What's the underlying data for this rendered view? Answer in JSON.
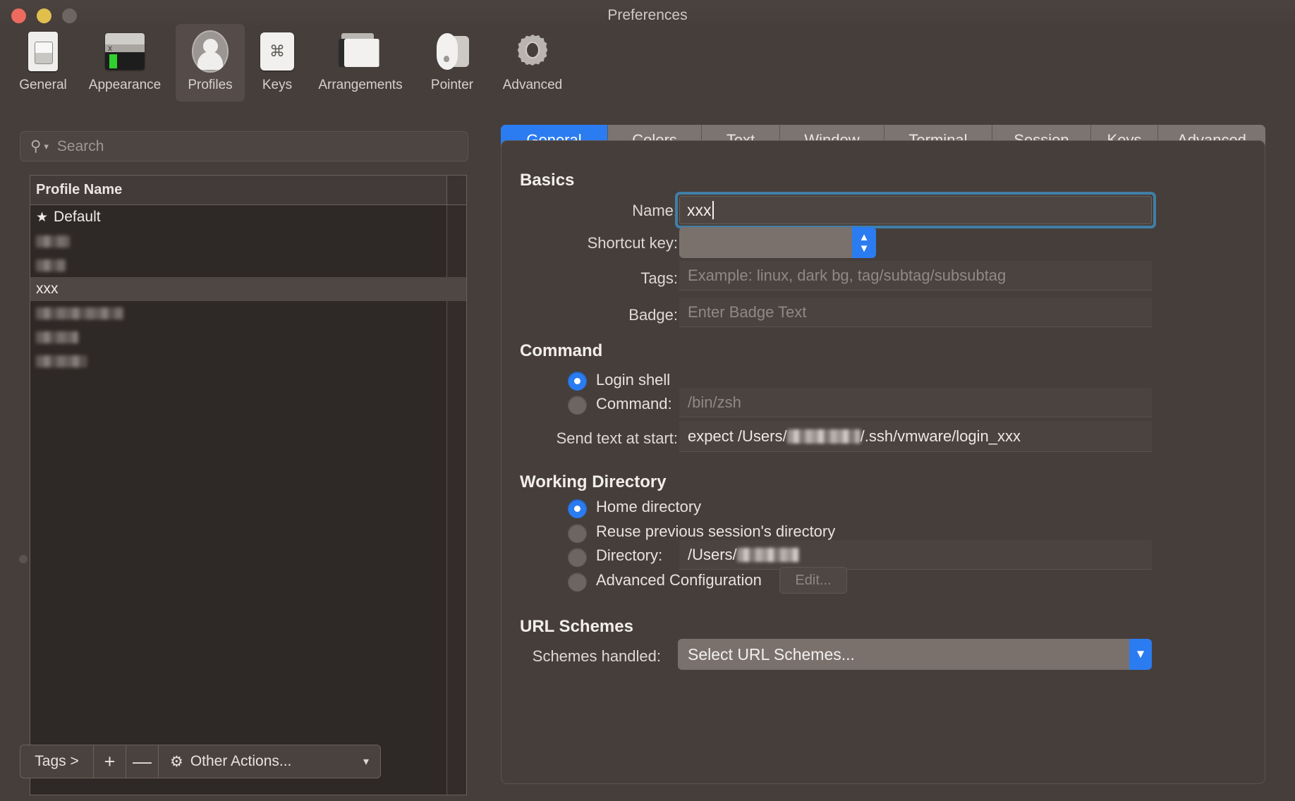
{
  "window": {
    "title": "Preferences",
    "traffic_lights": [
      "close",
      "minimize",
      "zoom"
    ]
  },
  "toolbar": {
    "items": [
      {
        "label": "General",
        "icon": "general-icon",
        "selected": false
      },
      {
        "label": "Appearance",
        "icon": "appearance-icon",
        "selected": false
      },
      {
        "label": "Profiles",
        "icon": "profiles-icon",
        "selected": true
      },
      {
        "label": "Keys",
        "icon": "keys-icon",
        "selected": false
      },
      {
        "label": "Arrangements",
        "icon": "arrangements-icon",
        "selected": false
      },
      {
        "label": "Pointer",
        "icon": "pointer-icon",
        "selected": false
      },
      {
        "label": "Advanced",
        "icon": "advanced-icon",
        "selected": false
      }
    ]
  },
  "sidebar": {
    "search": {
      "placeholder": "Search",
      "value": ""
    },
    "table": {
      "column_header": "Profile Name",
      "rows": [
        {
          "name": "Default",
          "starred": true,
          "selected": false,
          "redacted": false
        },
        {
          "name": "",
          "starred": false,
          "selected": false,
          "redacted": true
        },
        {
          "name": "",
          "starred": false,
          "selected": false,
          "redacted": true
        },
        {
          "name": "xxx",
          "starred": false,
          "selected": true,
          "redacted": false
        },
        {
          "name": "",
          "starred": false,
          "selected": false,
          "redacted": true
        },
        {
          "name": "",
          "starred": false,
          "selected": false,
          "redacted": true
        },
        {
          "name": "",
          "starred": false,
          "selected": false,
          "redacted": true
        }
      ]
    },
    "bottom_bar": {
      "tags_label": "Tags >",
      "add_label": "+",
      "remove_label": "—",
      "other_actions_label": "Other Actions...",
      "gear_icon": "gear-icon",
      "chevron_icon": "chevron-down-icon"
    }
  },
  "main": {
    "tabs": [
      {
        "label": "General",
        "active": true
      },
      {
        "label": "Colors",
        "active": false
      },
      {
        "label": "Text",
        "active": false
      },
      {
        "label": "Window",
        "active": false
      },
      {
        "label": "Terminal",
        "active": false
      },
      {
        "label": "Session",
        "active": false
      },
      {
        "label": "Keys",
        "active": false
      },
      {
        "label": "Advanced",
        "active": false
      }
    ],
    "basics": {
      "heading": "Basics",
      "name_label": "Name:",
      "name_value": "xxx",
      "shortcut_label": "Shortcut key:",
      "shortcut_value": "",
      "tags_label": "Tags:",
      "tags_placeholder": "Example: linux, dark bg, tag/subtag/subsubtag",
      "tags_value": "",
      "badge_label": "Badge:",
      "badge_placeholder": "Enter Badge Text",
      "badge_value": ""
    },
    "command": {
      "heading": "Command",
      "login_shell_label": "Login shell",
      "login_shell_selected": true,
      "command_label": "Command:",
      "command_selected": false,
      "command_placeholder": "/bin/zsh",
      "send_text_label": "Send text at start:",
      "send_text_prefix": "expect /Users/",
      "send_text_suffix": "/.ssh/vmware/login_xxx"
    },
    "working_directory": {
      "heading": "Working Directory",
      "home_label": "Home directory",
      "home_selected": true,
      "reuse_label": "Reuse previous session's directory",
      "reuse_selected": false,
      "directory_label": "Directory:",
      "directory_selected": false,
      "directory_prefix": "/Users/",
      "advanced_label": "Advanced Configuration",
      "advanced_selected": false,
      "edit_button_label": "Edit..."
    },
    "url_schemes": {
      "heading": "URL Schemes",
      "schemes_label": "Schemes handled:",
      "schemes_value": "Select URL Schemes..."
    }
  },
  "colors": {
    "window_bg": "#463e3b",
    "accent_blue": "#2b7cf0",
    "focus_ring": "#3f7fa6",
    "table_bg": "#2e2826",
    "selection": "#4e4744"
  }
}
